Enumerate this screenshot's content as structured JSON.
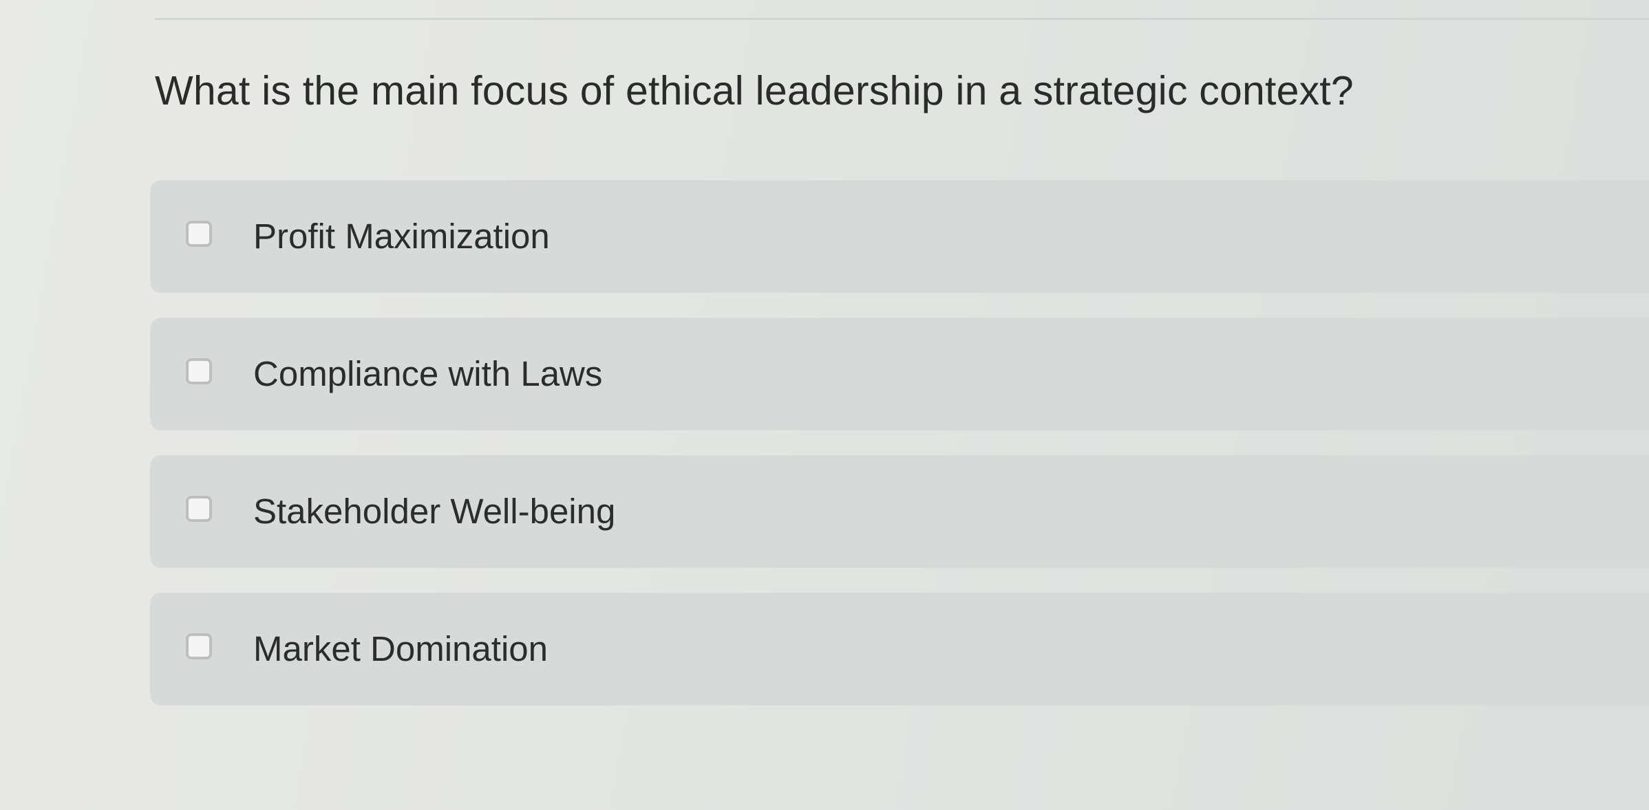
{
  "question": {
    "text": "What is the main focus of ethical leadership in a strategic context?"
  },
  "options": [
    {
      "label": "Profit Maximization",
      "checked": false
    },
    {
      "label": "Compliance with Laws",
      "checked": false
    },
    {
      "label": "Stakeholder Well-being",
      "checked": false
    },
    {
      "label": "Market Domination",
      "checked": false
    }
  ],
  "colors": {
    "background": "#e4e6e4",
    "option_background": "#d8dad9",
    "text": "#2b2b2b",
    "checkbox_border": "#bdbfbe"
  }
}
